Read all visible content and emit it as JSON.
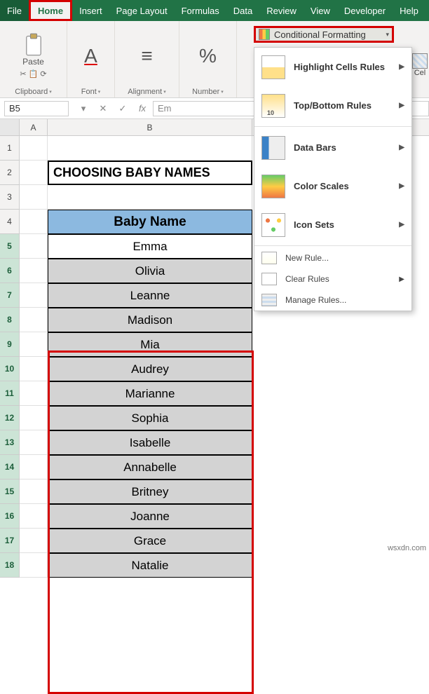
{
  "ribbon": {
    "tabs": [
      "File",
      "Home",
      "Insert",
      "Page Layout",
      "Formulas",
      "Data",
      "Review",
      "View",
      "Developer",
      "Help"
    ],
    "active": "Home",
    "groups": {
      "clipboard": {
        "label": "Clipboard",
        "paste": "Paste"
      },
      "font": {
        "label": "Font",
        "glyph": "A"
      },
      "alignment": {
        "label": "Alignment",
        "glyph": "≡"
      },
      "number": {
        "label": "Number",
        "glyph": "%"
      }
    },
    "conditional_formatting": {
      "label": "Conditional Formatting",
      "menu": {
        "highlight": "Highlight Cells Rules",
        "topbottom": "Top/Bottom Rules",
        "databars": "Data Bars",
        "colorscales": "Color Scales",
        "iconsets": "Icon Sets",
        "newrule": "New Rule...",
        "clear": "Clear Rules",
        "manage": "Manage Rules..."
      }
    },
    "cell": "Cel"
  },
  "formula_bar": {
    "name": "B5",
    "fx": "fx",
    "value": "Em"
  },
  "columns": [
    "A",
    "B"
  ],
  "sheet": {
    "title": "CHOOSING BABY NAMES",
    "header": "Baby Name",
    "names": [
      "Emma",
      "Olivia",
      "Leanne",
      "Madison",
      "Mia",
      "Audrey",
      "Marianne",
      "Sophia",
      "Isabelle",
      "Annabelle",
      "Britney",
      "Joanne",
      "Grace",
      "Natalie"
    ]
  },
  "rows": [
    1,
    2,
    3,
    4,
    5,
    6,
    7,
    8,
    9,
    10,
    11,
    12,
    13,
    14,
    15,
    16,
    17,
    18
  ],
  "watermark": "wsxdn.com"
}
